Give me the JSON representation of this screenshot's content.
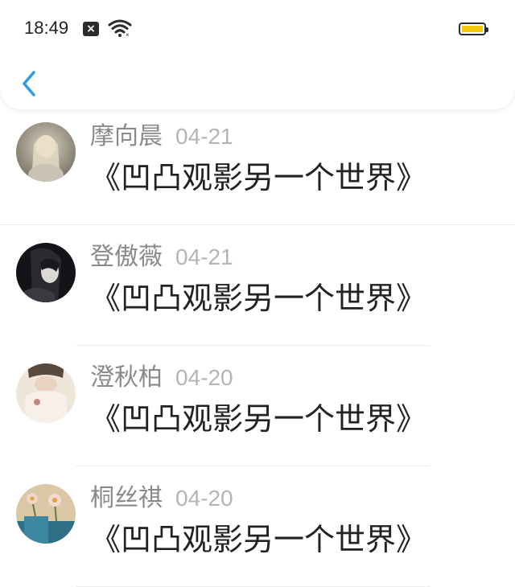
{
  "status_bar": {
    "time": "18:49",
    "notification_icon": "x-notification-icon",
    "wifi_icon": "wifi-icon",
    "battery_icon": "battery-icon",
    "battery_color": "#f3c90c"
  },
  "header": {
    "back_icon": "chevron-left-icon",
    "back_color": "#2b9be0"
  },
  "comments": [
    {
      "author": "摩向晨",
      "date": "04-21",
      "text": "《凹凸观影另一个世界》"
    },
    {
      "author": "登傲薇",
      "date": "04-21",
      "text": "《凹凸观影另一个世界》"
    },
    {
      "author": "澄秋柏",
      "date": "04-20",
      "text": "《凹凸观影另一个世界》"
    },
    {
      "author": "桐丝祺",
      "date": "04-20",
      "text": "《凹凸观影另一个世界》"
    }
  ]
}
